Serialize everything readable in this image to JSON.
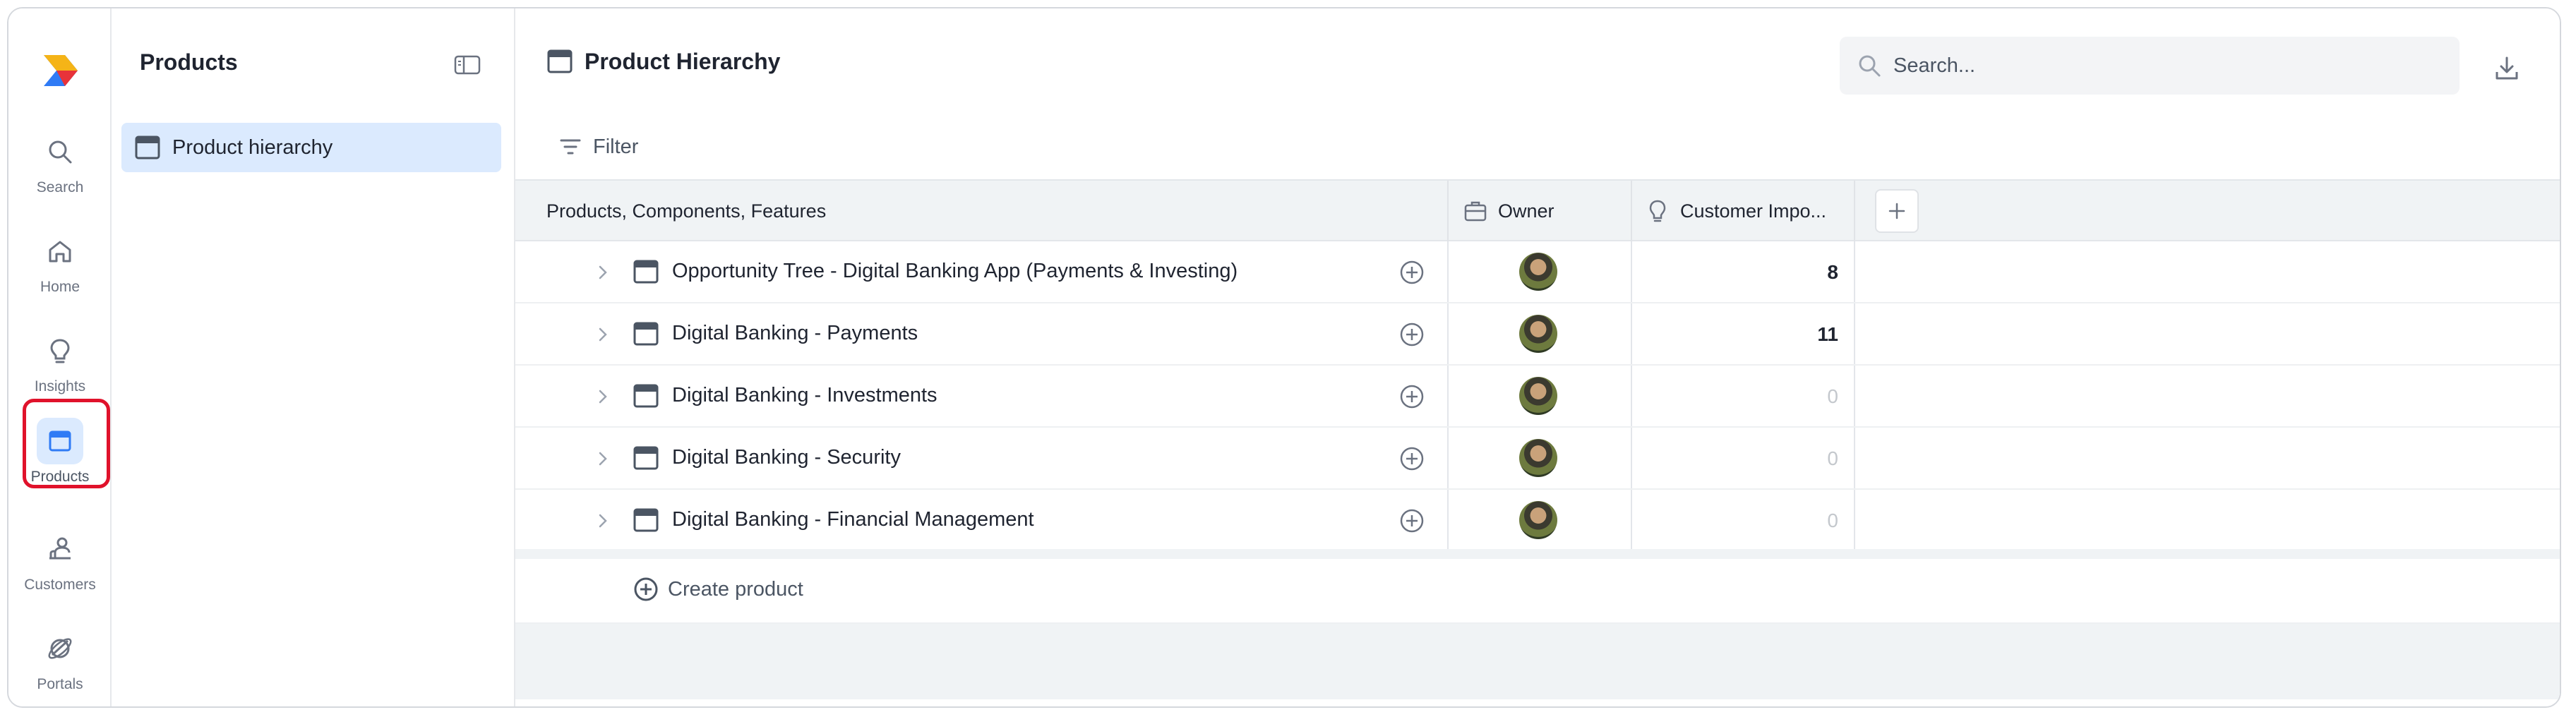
{
  "rail": {
    "items": [
      {
        "label": "Search",
        "icon": "search-icon"
      },
      {
        "label": "Home",
        "icon": "home-icon"
      },
      {
        "label": "Insights",
        "icon": "lightbulb-icon"
      },
      {
        "label": "Products",
        "icon": "product-window-icon",
        "active": true
      },
      {
        "label": "Customers",
        "icon": "customers-icon"
      },
      {
        "label": "Portals",
        "icon": "portals-icon"
      }
    ]
  },
  "sidebar": {
    "title": "Products",
    "items": [
      {
        "label": "Product hierarchy",
        "selected": true
      }
    ]
  },
  "main": {
    "title": "Product Hierarchy",
    "search_placeholder": "Search...",
    "filter_label": "Filter"
  },
  "table": {
    "columns": {
      "name": "Products, Components, Features",
      "owner": "Owner",
      "impact": "Customer Impo..."
    },
    "rows": [
      {
        "name": "Opportunity Tree - Digital Banking App (Payments & Investing)",
        "impact": "8"
      },
      {
        "name": "Digital Banking - Payments",
        "impact": "11"
      },
      {
        "name": "Digital Banking - Investments",
        "impact": "0"
      },
      {
        "name": "Digital Banking - Security",
        "impact": "0"
      },
      {
        "name": "Digital Banking - Financial Management",
        "impact": "0"
      }
    ],
    "create_label": "Create product"
  },
  "colors": {
    "accent": "#2f7bf5",
    "active_bg": "#dbeafe",
    "highlight_outline": "#e0122b"
  }
}
